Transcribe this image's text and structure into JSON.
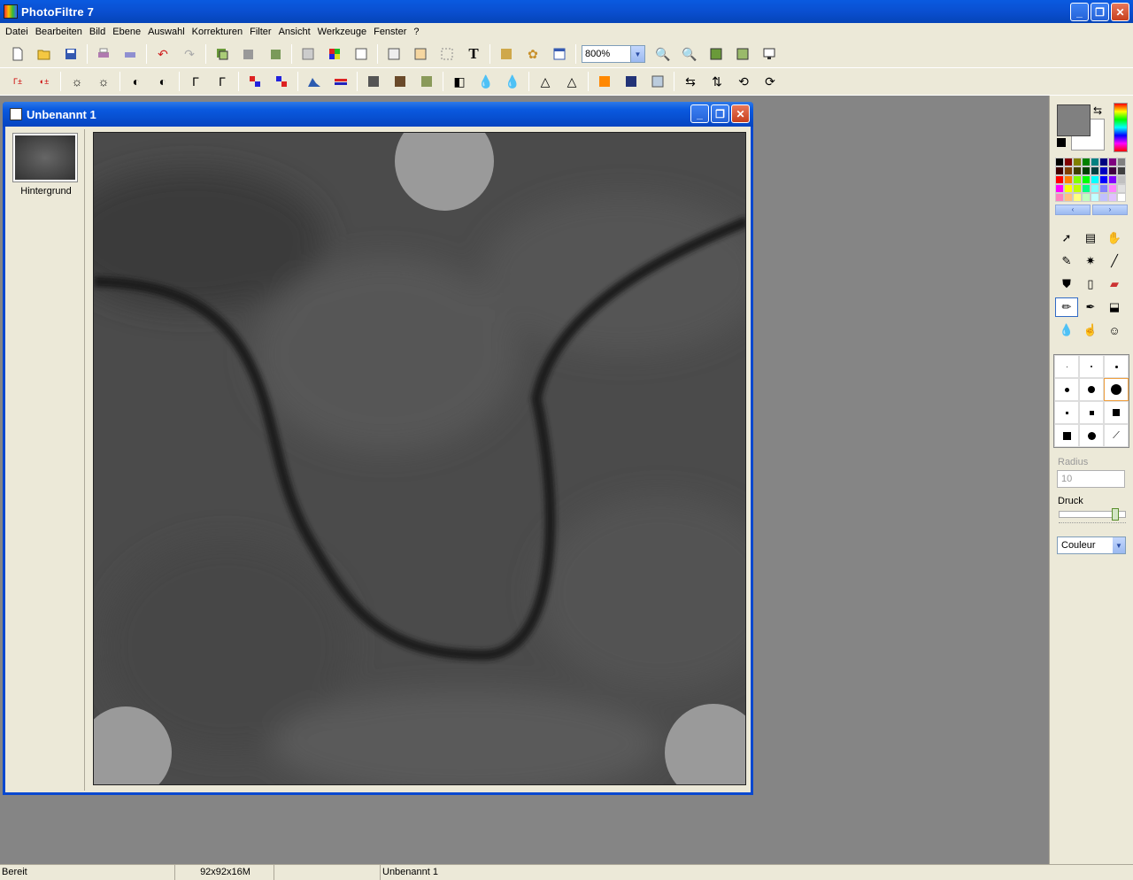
{
  "app": {
    "title": "PhotoFiltre 7"
  },
  "menu": [
    "Datei",
    "Bearbeiten",
    "Bild",
    "Ebene",
    "Auswahl",
    "Korrekturen",
    "Filter",
    "Ansicht",
    "Werkzeuge",
    "Fenster",
    "?"
  ],
  "toolbar": {
    "zoom_value": "800%",
    "text_tool_glyph": "T"
  },
  "document": {
    "title": "Unbenannt 1",
    "layer_name": "Hintergrund"
  },
  "tools_panel": {
    "radius_label": "Radius",
    "radius_value": "10",
    "pressure_label": "Druck",
    "mode_value": "Couleur"
  },
  "colors": {
    "foreground": "#808080",
    "background": "#ffffff",
    "palette": [
      "#000000",
      "#800000",
      "#808000",
      "#008000",
      "#008080",
      "#000080",
      "#800080",
      "#808080",
      "#400000",
      "#804000",
      "#404000",
      "#004000",
      "#004040",
      "#0000c0",
      "#400040",
      "#404040",
      "#ff0000",
      "#ff8000",
      "#80ff00",
      "#00ff00",
      "#00ffff",
      "#0000ff",
      "#8000ff",
      "#c0c0c0",
      "#ff00ff",
      "#ffff00",
      "#c0ff00",
      "#00ff80",
      "#80ffff",
      "#8080ff",
      "#ff80ff",
      "#e0e0e0",
      "#ff80c0",
      "#ffc080",
      "#ffff80",
      "#c0ffc0",
      "#c0ffff",
      "#c0c0ff",
      "#e0c0ff",
      "#ffffff"
    ]
  },
  "status": {
    "state": "Bereit",
    "image_info": "92x92x16M",
    "doc_name": "Unbenannt 1"
  }
}
